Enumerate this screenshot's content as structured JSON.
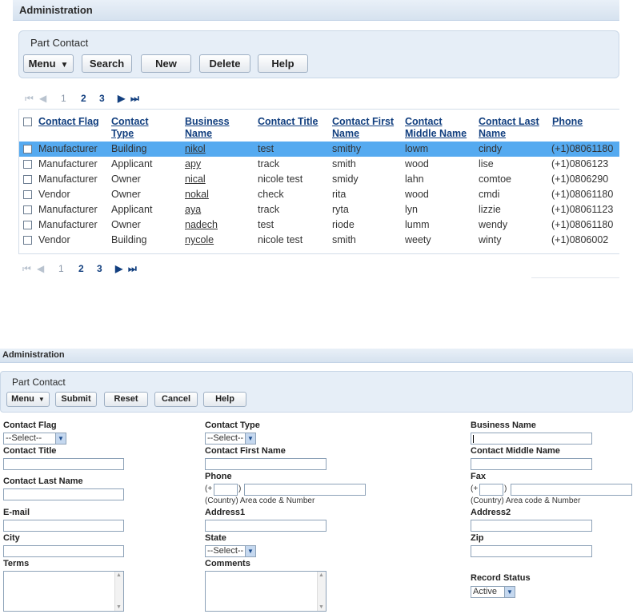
{
  "list_view": {
    "admin_title": "Administration",
    "panel_title": "Part Contact",
    "buttons": {
      "menu": "Menu",
      "search": "Search",
      "new": "New",
      "delete": "Delete",
      "help": "Help"
    },
    "pager": {
      "first": "⏮",
      "prev": "◀",
      "pages": [
        "1",
        "2",
        "3"
      ],
      "next": "▶",
      "last": "⏭"
    },
    "columns": [
      "Contact Flag",
      "Contact Type",
      "Business Name",
      "Contact Title",
      "Contact First Name",
      "Contact Middle Name",
      "Contact Last Name",
      "Phone"
    ],
    "rows": [
      {
        "flag": "Manufacturer",
        "type": "Building",
        "business": "nikol",
        "title": "test",
        "first": "smithy",
        "middle": "lowm",
        "last": "cindy",
        "phone": "(+1)08061180",
        "selected": true
      },
      {
        "flag": "Manufacturer",
        "type": "Applicant",
        "business": "apy",
        "title": "track",
        "first": "smith",
        "middle": "wood",
        "last": "lise",
        "phone": "(+1)0806123",
        "selected": false
      },
      {
        "flag": "Manufacturer",
        "type": "Owner",
        "business": "nical",
        "title": "nicole test",
        "first": "smidy",
        "middle": "lahn",
        "last": "comtoe",
        "phone": "(+1)0806290",
        "selected": false
      },
      {
        "flag": "Vendor",
        "type": "Owner",
        "business": "nokal",
        "title": "check",
        "first": "rita",
        "middle": "wood",
        "last": "cmdi",
        "phone": "(+1)08061180",
        "selected": false
      },
      {
        "flag": "Manufacturer",
        "type": "Applicant",
        "business": "aya",
        "title": "track",
        "first": "ryta",
        "middle": "lyn",
        "last": "lizzie",
        "phone": "(+1)08061123",
        "selected": false
      },
      {
        "flag": "Manufacturer",
        "type": "Owner",
        "business": "nadech",
        "title": "test",
        "first": "riode",
        "middle": "lumm",
        "last": "wendy",
        "phone": "(+1)08061180",
        "selected": false
      },
      {
        "flag": "Vendor",
        "type": "Building",
        "business": "nycole",
        "title": "nicole test",
        "first": "smith",
        "middle": "weety",
        "last": "winty",
        "phone": "(+1)0806002",
        "selected": false
      }
    ],
    "selected_row_color": "#55aaf0"
  },
  "form_view": {
    "admin_title": "Administration",
    "panel_title": "Part Contact",
    "buttons": {
      "menu": "Menu",
      "submit": "Submit",
      "reset": "Reset",
      "cancel": "Cancel",
      "help": "Help"
    },
    "fields": {
      "contact_flag": {
        "label": "Contact Flag",
        "value": "--Select--"
      },
      "contact_type": {
        "label": "Contact Type",
        "value": "--Select--"
      },
      "business_name": {
        "label": "Business Name"
      },
      "contact_title": {
        "label": "Contact Title"
      },
      "contact_first_name": {
        "label": "Contact First Name"
      },
      "contact_middle_name": {
        "label": "Contact Middle Name"
      },
      "contact_last_name": {
        "label": "Contact Last Name"
      },
      "phone": {
        "label": "Phone",
        "prefix": "(+",
        "suffix": ")",
        "hint": "(Country)  Area code & Number"
      },
      "fax": {
        "label": "Fax",
        "prefix": "(+",
        "suffix": ")",
        "hint": "(Country)  Area code & Number"
      },
      "email": {
        "label": "E-mail"
      },
      "address1": {
        "label": "Address1"
      },
      "address2": {
        "label": "Address2"
      },
      "city": {
        "label": "City"
      },
      "state": {
        "label": "State",
        "value": "--Select--"
      },
      "zip": {
        "label": "Zip"
      },
      "terms": {
        "label": "Terms"
      },
      "comments": {
        "label": "Comments"
      },
      "record_status": {
        "label": "Record Status",
        "value": "Active"
      }
    }
  }
}
